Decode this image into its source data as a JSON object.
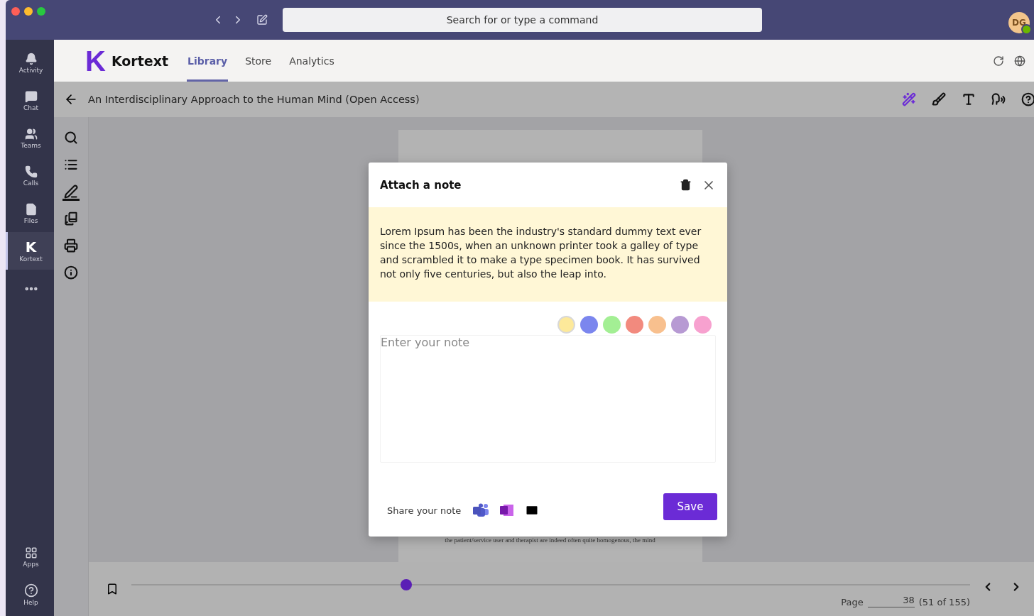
{
  "title_bar": {
    "search": {
      "placeholder": "Search for or type a command"
    },
    "avatar": {
      "initials": "DG",
      "online": true
    }
  },
  "rail": {
    "items": [
      {
        "kind": "activity",
        "label": "Activity",
        "selected": false
      },
      {
        "kind": "chat",
        "label": "Chat",
        "selected": false
      },
      {
        "kind": "teams",
        "label": "Teams",
        "selected": false
      },
      {
        "kind": "calls",
        "label": "Calls",
        "selected": false
      },
      {
        "kind": "files",
        "label": "Files",
        "selected": false
      },
      {
        "kind": "app",
        "label": "Kortext",
        "glyph": "K",
        "selected": true
      },
      {
        "kind": "more",
        "selected": false
      }
    ],
    "bottom_items": [
      {
        "kind": "apps",
        "label": "Apps"
      },
      {
        "kind": "help",
        "label": "Help"
      }
    ]
  },
  "app_header": {
    "logo_mark": "K",
    "brand": "Kortext",
    "tabs": [
      {
        "label": "Library",
        "selected": true
      },
      {
        "label": "Store",
        "selected": false
      },
      {
        "label": "Analytics",
        "selected": false
      }
    ]
  },
  "book": {
    "title": "An Interdisciplinary Approach to the Human Mind (Open Access)",
    "page_line": "the patient/service user and therapist are indeed often quite homogenous, the mind"
  },
  "tools": [
    {
      "kind": "search",
      "active": false
    },
    {
      "kind": "contents",
      "active": false
    },
    {
      "kind": "annotate",
      "active": true
    },
    {
      "kind": "bookmarks",
      "active": false
    },
    {
      "kind": "print",
      "active": false
    },
    {
      "kind": "info",
      "active": false
    }
  ],
  "reader_tools": [
    {
      "kind": "wand",
      "active": true
    },
    {
      "kind": "brush",
      "active": false
    },
    {
      "kind": "text-size",
      "active": false
    },
    {
      "kind": "read-aloud",
      "active": false
    },
    {
      "kind": "help",
      "active": false
    }
  ],
  "note_dialog": {
    "title": "Attach a note",
    "quote": "Lorem Ipsum has been the industry's standard dummy text ever since the 1500s, when an unknown printer took a galley of type and scrambled it to make a type specimen book. It has survived not only five centuries, but also the leap into.",
    "placeholder": "Enter your note",
    "colors": [
      {
        "color": "#fde99a",
        "selected": true
      },
      {
        "color": "#7b86ee",
        "selected": false
      },
      {
        "color": "#a3ef94",
        "selected": false
      },
      {
        "color": "#f28a7e",
        "selected": false
      },
      {
        "color": "#f8c08e",
        "selected": false
      },
      {
        "color": "#b79ad3",
        "selected": false
      },
      {
        "color": "#f7a1cf",
        "selected": false
      }
    ],
    "share_label": "Share your note",
    "save": "Save"
  },
  "pager": {
    "level": 0.33,
    "page_label": "Page",
    "page_value": "38",
    "page_count": "(51 of 155)"
  }
}
